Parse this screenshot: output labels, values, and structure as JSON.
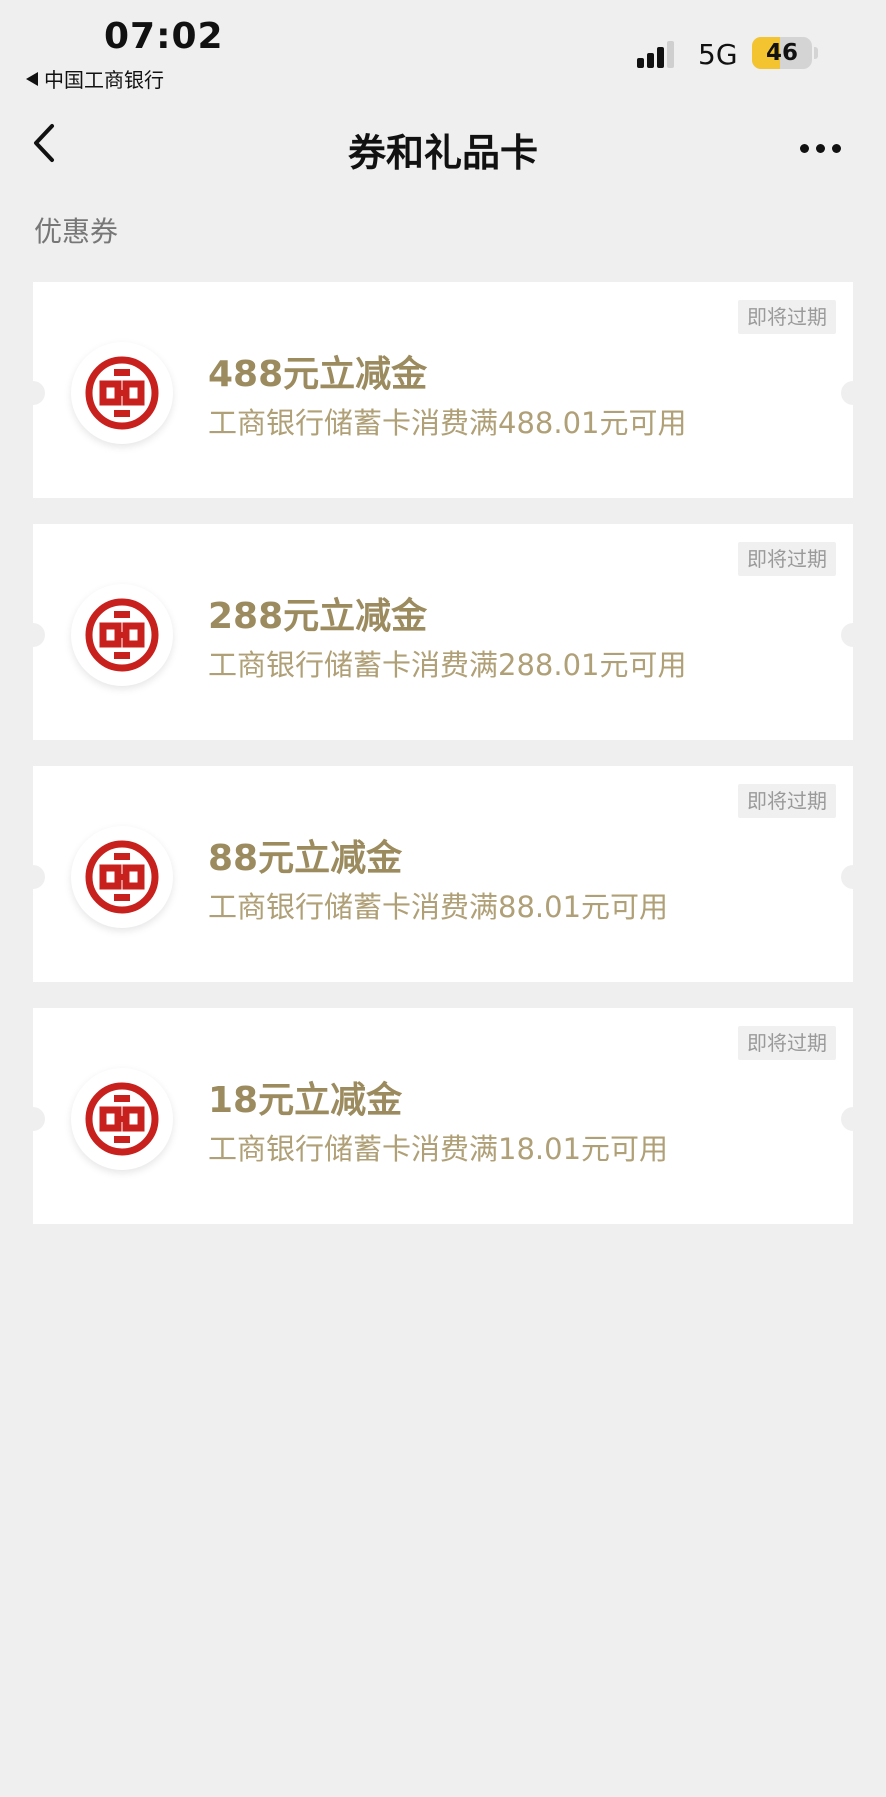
{
  "status_bar": {
    "time": "07:02",
    "back_app_label": "中国工商银行",
    "network": "5G",
    "battery_level": "46",
    "battery_fraction": 0.46
  },
  "nav": {
    "title": "券和礼品卡"
  },
  "section": {
    "label": "优惠券"
  },
  "coupons": [
    {
      "title": "488元立减金",
      "desc": "工商银行储蓄卡消费满488.01元可用",
      "badge": "即将过期"
    },
    {
      "title": "288元立减金",
      "desc": "工商银行储蓄卡消费满288.01元可用",
      "badge": "即将过期"
    },
    {
      "title": "88元立减金",
      "desc": "工商银行储蓄卡消费满88.01元可用",
      "badge": "即将过期"
    },
    {
      "title": "18元立减金",
      "desc": "工商银行储蓄卡消费满18.01元可用",
      "badge": "即将过期"
    }
  ],
  "colors": {
    "background": "#efefef",
    "card": "#ffffff",
    "title_gold": "#9b8b5e",
    "desc_gold": "#b0a077",
    "icbc_red": "#c8201d",
    "battery_yellow": "#f4c430"
  },
  "icons": {
    "back": "chevron-left-icon",
    "more": "more-dots-icon",
    "logo": "icbc-logo-icon"
  }
}
